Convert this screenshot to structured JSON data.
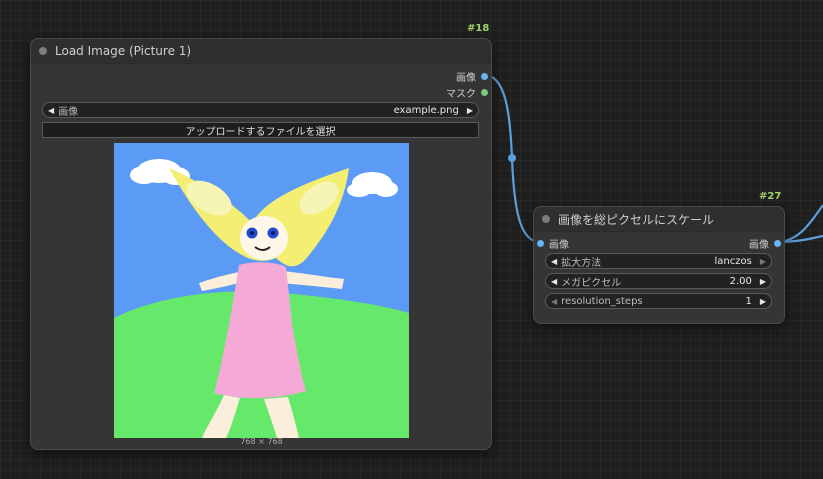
{
  "nodes": {
    "load_image": {
      "id": "#18",
      "title": "Load Image (Picture 1)",
      "outputs": [
        {
          "label": "画像",
          "color": "#64b5f6"
        },
        {
          "label": "マスク",
          "color": "#81c784"
        }
      ],
      "image_widget": {
        "label": "画像",
        "value": "example.png"
      },
      "upload_button": "アップロードするファイルを選択",
      "preview_caption": "768 × 768"
    },
    "scale": {
      "id": "#27",
      "title": "画像を総ピクセルにスケール",
      "input": {
        "label": "画像",
        "color": "#64b5f6"
      },
      "output": {
        "label": "画像",
        "color": "#64b5f6"
      },
      "widgets": [
        {
          "label": "拡大方法",
          "value": "lanczos"
        },
        {
          "label": "メガピクセル",
          "value": "2.00"
        },
        {
          "label": "resolution_steps",
          "value": "1"
        }
      ]
    }
  },
  "colors": {
    "link": "#5aa0dc",
    "id_label": "#9fd66a",
    "node_bg": "#353535"
  }
}
